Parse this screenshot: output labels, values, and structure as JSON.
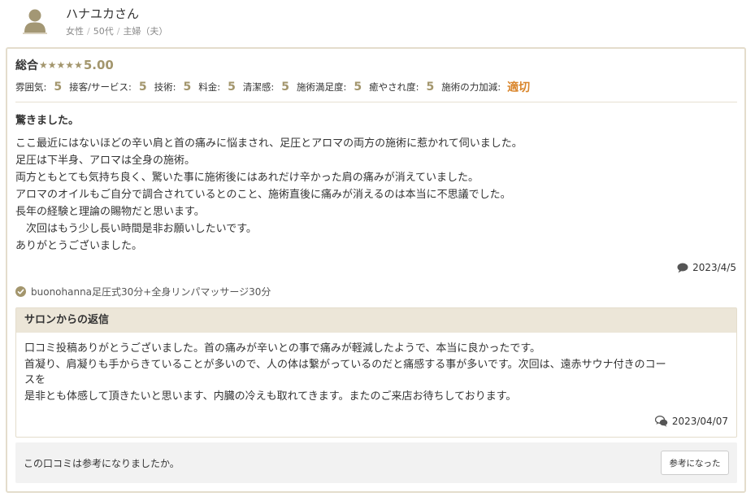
{
  "reviewer": {
    "name": "ハナユカさん",
    "gender": "女性",
    "age": "50代",
    "occupation": "主婦（夫）"
  },
  "review": {
    "overall_label": "総合",
    "overall_score": "5.00",
    "star_count": 5,
    "ratings": [
      {
        "label": "雰囲気:",
        "value": "5"
      },
      {
        "label": "接客/サービス:",
        "value": "5"
      },
      {
        "label": "技術:",
        "value": "5"
      },
      {
        "label": "料金:",
        "value": "5"
      },
      {
        "label": "清潔感:",
        "value": "5"
      },
      {
        "label": "施術満足度:",
        "value": "5"
      },
      {
        "label": "癒やされ度:",
        "value": "5"
      },
      {
        "label": "施術の力加減:",
        "value": "適切"
      }
    ],
    "title": "驚きました。",
    "body_lines": [
      "ここ最近にはないほどの辛い肩と首の痛みに悩まされ、足圧とアロマの両方の施術に惹かれて伺いました。",
      "足圧は下半身、アロマは全身の施術。",
      "両方ともとても気持ち良く、驚いた事に施術後にはあれだけ辛かった肩の痛みが消えていました。",
      "アロマのオイルもご自分で調合されているとのこと、施術直後に痛みが消えるのは本当に不思議でした。",
      "長年の経験と理論の賜物だと思います。",
      "　次回はもう少し長い時間是非お願いしたいです。",
      "ありがとうございました。"
    ],
    "date": "2023/4/5",
    "menu": "buonohanna足圧式30分+全身リンパマッサージ30分"
  },
  "reply": {
    "heading": "サロンからの返信",
    "body_lines": [
      "口コミ投稿ありがとうございました。首の痛みが辛いとの事で痛みが軽減したようで、本当に良かったです。",
      "首凝り、肩凝りも手からきていることが多いので、人の体は繋がっているのだと痛感する事が多いです。次回は、遠赤サウナ付きのコー",
      "スを",
      "是非とも体感して頂きたいと思います、内臓の冷えも取れてきます。またのご来店お待ちしております。"
    ],
    "date": "2023/04/07"
  },
  "helpful": {
    "question": "この口コミは参考になりましたか。",
    "button_label": "参考になった"
  },
  "colors": {
    "star": "#a3966d",
    "accent_orange": "#d9852b",
    "border": "#e4ddcc",
    "reply_header_bg": "#ece6d8"
  }
}
